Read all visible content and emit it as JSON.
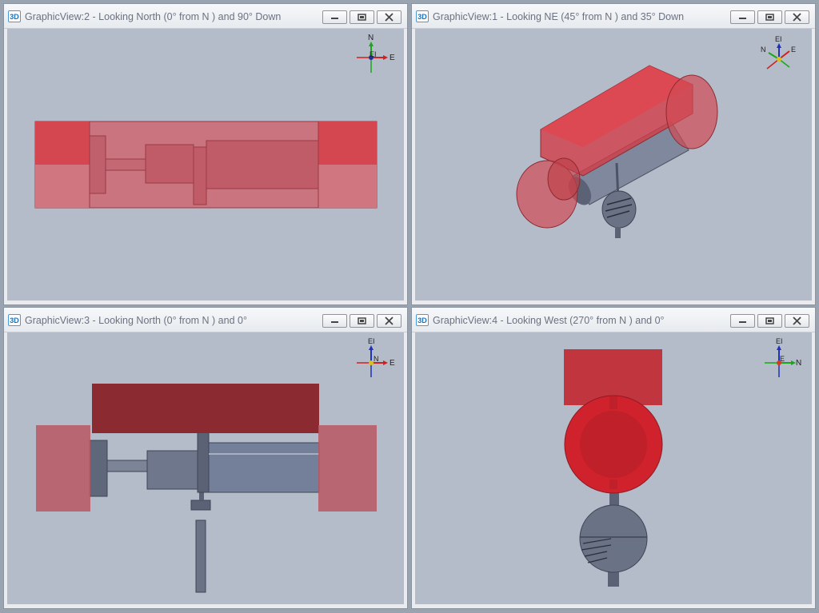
{
  "views": [
    {
      "app_icon": "3D",
      "title": "GraphicView:2 - Looking North (0° from N ) and 90° Down",
      "axes": [
        "N",
        "EI",
        "E"
      ]
    },
    {
      "app_icon": "3D",
      "title": "GraphicView:1 - Looking NE (45° from N ) and 35° Down",
      "axes": [
        "EI",
        "N",
        "E"
      ]
    },
    {
      "app_icon": "3D",
      "title": "GraphicView:3 - Looking North (0° from N ) and 0°",
      "axes": [
        "EI",
        "N",
        "E"
      ]
    },
    {
      "app_icon": "3D",
      "title": "GraphicView:4 - Looking West (270° from N ) and 0°",
      "axes": [
        "EI",
        "E",
        "N"
      ]
    }
  ],
  "colors": {
    "viewport_bg": "#b3bcc8",
    "model_red": "#c8323c",
    "model_steel": "#5b6275"
  }
}
